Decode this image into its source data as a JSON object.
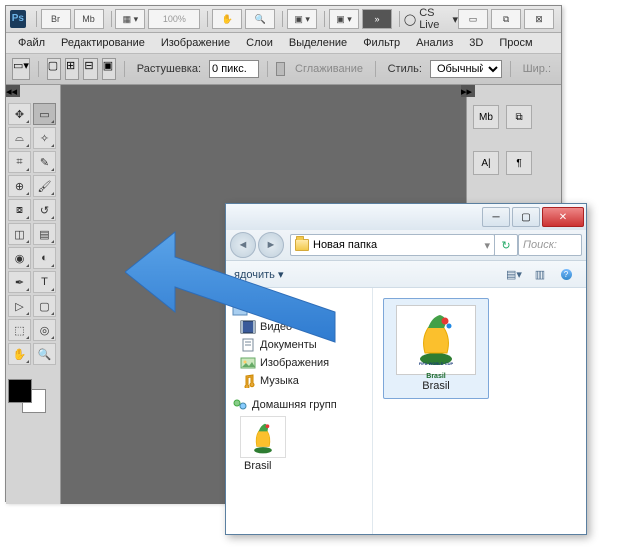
{
  "ps": {
    "logo": "Ps",
    "top_icons": [
      "Br",
      "Mb"
    ],
    "zoom": "100%",
    "cslive": "CS Live",
    "menu": [
      "Файл",
      "Редактирование",
      "Изображение",
      "Слои",
      "Выделение",
      "Фильтр",
      "Анализ",
      "3D",
      "Просм"
    ],
    "options": {
      "feather_label": "Растушевка:",
      "feather_value": "0 пикс.",
      "antialias": "Сглаживание",
      "style_label": "Стиль:",
      "style_value": "Обычный",
      "width_label": "Шир.:"
    },
    "right_panel": {
      "mb": "Mb",
      "a": "A|"
    }
  },
  "explorer": {
    "path": "Новая папка",
    "search_placeholder": "Поиск:",
    "toolbar_organize": "ядочить ▾",
    "tree": {
      "libraries": "Библиотеки",
      "video": "Видео",
      "documents": "Документы",
      "images": "Изображения",
      "music": "Музыка",
      "homegroup": "Домашняя групп",
      "home_item": "Brasil"
    },
    "file": {
      "name": "Brasil",
      "caption1": "FIFA WORLD CUP",
      "caption2": "Brasil"
    }
  }
}
